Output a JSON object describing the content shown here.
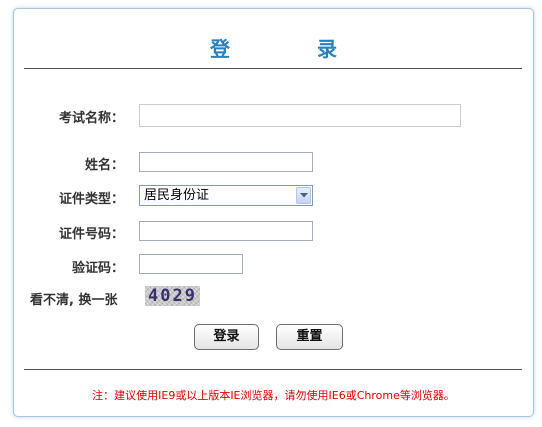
{
  "title": "登 录",
  "form": {
    "exam_name_label": "考试名称：",
    "exam_name_value": "",
    "name_label": "姓名：",
    "name_value": "",
    "id_type_label": "证件类型：",
    "id_type_selected": "居民身份证",
    "id_number_label": "证件号码：",
    "id_number_value": "",
    "captcha_label": "验证码：",
    "captcha_value": "",
    "refresh_captcha_text": "看不清, 换一张",
    "captcha_image_text": "4029"
  },
  "buttons": {
    "login": "登录",
    "reset": "重置"
  },
  "note": "注：建议使用IE9或以上版本IE浏览器，请勿使用IE6或Chrome等浏览器。",
  "colors": {
    "title": "#2a7fbf",
    "note": "#e00000",
    "border": "#a9c3dc"
  }
}
